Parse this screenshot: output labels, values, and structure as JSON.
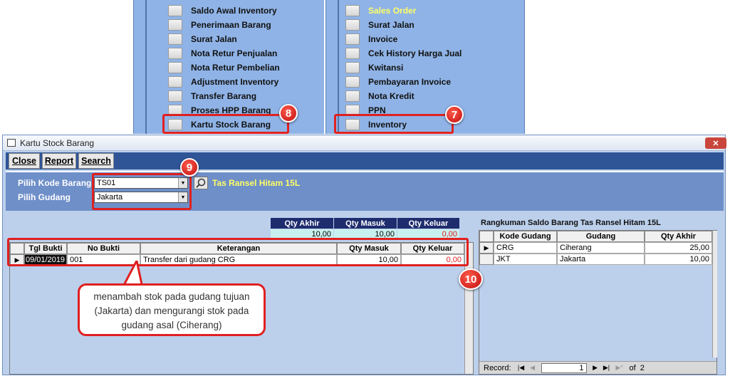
{
  "menu_left": [
    "Saldo Awal Inventory",
    "Penerimaan Barang",
    "Surat Jalan",
    "Nota Retur Penjualan",
    "Nota Retur Pembelian",
    "Adjustment Inventory",
    "Transfer Barang",
    "Proses HPP Barang",
    "Kartu Stock Barang"
  ],
  "menu_right": [
    "Sales Order",
    "Surat Jalan",
    "Invoice",
    "Cek History Harga Jual",
    "Kwitansi",
    "Pembayaran Invoice",
    "Nota Kredit",
    "PPN",
    "Inventory"
  ],
  "badges": {
    "b7": "7",
    "b8": "8",
    "b9": "9",
    "b10": "10"
  },
  "window": {
    "title": "Kartu Stock Barang",
    "close_x": "✕"
  },
  "toolbar": {
    "close": "Close",
    "report": "Report",
    "search": "Search"
  },
  "filter": {
    "kode_label": "Pilih Kode Barang",
    "kode_value": "TS01",
    "gudang_label": "Pilih Gudang",
    "gudang_value": "Jakarta",
    "item_name": "Tas Ransel Hitam 15L"
  },
  "summary": {
    "headers": [
      "Qty Akhir",
      "Qty Masuk",
      "Qty Keluar"
    ],
    "values": [
      "10,00",
      "10,00",
      "0,00"
    ]
  },
  "main_grid": {
    "headers": [
      "Tgl Bukti",
      "No Bukti",
      "Keterangan",
      "Qty Masuk",
      "Qty Keluar"
    ],
    "rows": [
      [
        "09/01/2019",
        "001",
        "Transfer dari gudang CRG",
        "10,00",
        "0,00"
      ]
    ]
  },
  "rangkuman": {
    "title": "Rangkuman Saldo Barang Tas Ransel Hitam 15L",
    "headers": [
      "Kode Gudang",
      "Gudang",
      "Qty Akhir"
    ],
    "rows": [
      [
        "CRG",
        "Ciherang",
        "25,00"
      ],
      [
        "JKT",
        "Jakarta",
        "10,00"
      ]
    ]
  },
  "navigator": {
    "label": "Record:",
    "current": "1",
    "of": "of",
    "total": "2"
  },
  "callout": "menambah stok pada gudang tujuan (Jakarta) dan mengurangi stok pada gudang asal (Ciherang)",
  "colors": {
    "accent": "#e02020",
    "menu_bg": "#8fb3e6",
    "toolbar": "#2f5597"
  }
}
